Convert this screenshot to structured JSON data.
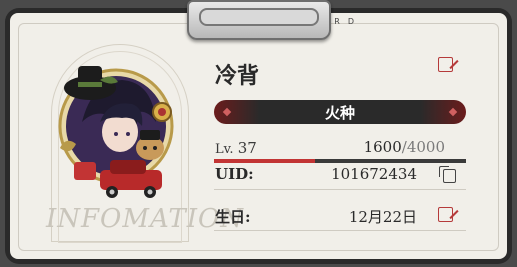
{
  "header": {
    "text": "VISITING CARD"
  },
  "watermark": {
    "text": "INFOMATION"
  },
  "profile": {
    "name": "冷背",
    "title_badge": "火种",
    "level_label": "Lv.",
    "level": "37",
    "exp_current": "1600",
    "exp_separator": "/",
    "exp_max": "4000",
    "exp_progress": 0.4,
    "uid_label": "UID:",
    "uid": "101672434",
    "birthday_label": "生日:",
    "birthday": "12月22日"
  },
  "colors": {
    "accent": "#c23434",
    "dark": "#2a2a2a",
    "paper": "#f1efe9"
  },
  "icons": {
    "edit": "edit-icon",
    "copy": "copy-icon",
    "clip": "clipboard-clip"
  }
}
